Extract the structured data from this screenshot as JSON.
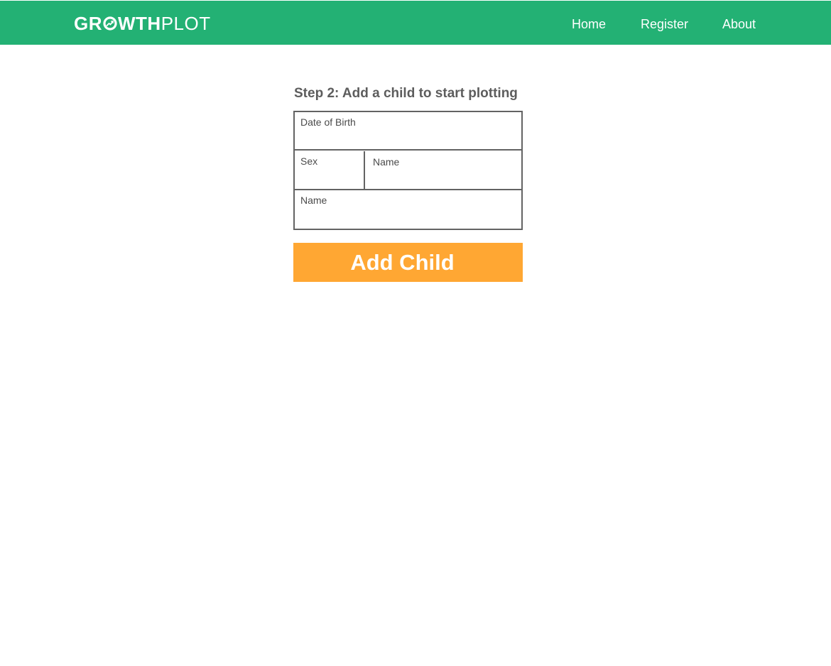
{
  "header": {
    "logo_bold": "GR",
    "logo_bold_tail": "WTH",
    "logo_thin": "PLOT",
    "logo_icon": "growth-chart-icon",
    "nav": {
      "home": "Home",
      "register": "Register",
      "about": "About"
    },
    "bg_color": "#23b174"
  },
  "main": {
    "title": "Step 2: Add a child to start plotting",
    "fields": {
      "dob_label": "Date of Birth",
      "sex_label": "Sex",
      "name_label_1": "Name",
      "name_label_2": "Name"
    },
    "add_button_label": "Add Child",
    "button_color": "#ffa733"
  }
}
